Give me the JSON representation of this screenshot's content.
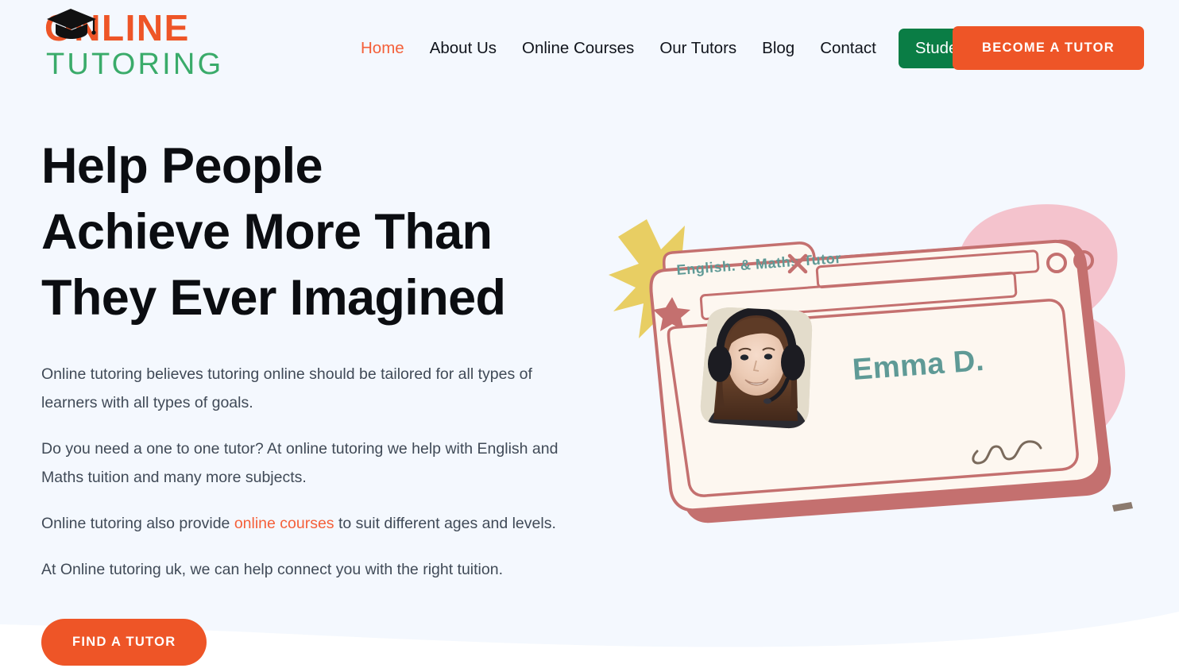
{
  "theme": {
    "bg": "#f4f8fe",
    "bg_bottom": "#ffffff",
    "accent_orange": "#ee5527",
    "accent_orange_light": "#f4603a",
    "accent_green": "#0a7d45",
    "logo_green": "#3aab6a",
    "text_dark": "#0b0d11",
    "text_body": "#404a57",
    "card_frame": "#c4706f",
    "card_fill": "#fdf7f0",
    "blob_pink": "#f4c3cd",
    "star_yellow": "#e8ce63",
    "teal_ink": "#5f9a96"
  },
  "header": {
    "logo": {
      "line1": "ONLINE",
      "line2": "TUTORING",
      "cap_icon": "graduation-cap-icon"
    },
    "nav": [
      {
        "label": "Home",
        "active": true
      },
      {
        "label": "About Us",
        "active": false
      },
      {
        "label": "Online Courses",
        "active": false
      },
      {
        "label": "Our Tutors",
        "active": false
      },
      {
        "label": "Blog",
        "active": false
      },
      {
        "label": "Contact",
        "active": false
      }
    ],
    "students_button": "Students",
    "tutor_button": "BECOME A TUTOR"
  },
  "hero": {
    "headline_line1": "Help People",
    "headline_line2": "Achieve More Than",
    "headline_line3": "They Ever Imagined",
    "paragraph1": "Online tutoring believes tutoring online should be tailored for all types of learners with all types of goals.",
    "paragraph2": "Do you need a one to one tutor? At online tutoring we help with English and Maths tuition and many more subjects.",
    "paragraph3_before": "Online tutoring also provide ",
    "paragraph3_link": "online courses",
    "paragraph3_after": " to suit different ages and levels.",
    "paragraph4": "At Online tutoring uk, we can help connect you with the right tuition.",
    "cta_button": "FIND A TUTOR"
  },
  "illustration": {
    "tab_label": "English. & Maths Tutor",
    "tutor_name": "Emma D.",
    "close_icon": "close-x-icon",
    "star_icon": "star-icon",
    "burst_icon": "star-burst-icon",
    "window_dot_1": "window-circle-icon",
    "window_dot_2": "window-circle-icon",
    "address_bar": "browser-address-bar",
    "search_bar": "browser-search-bar",
    "squiggle": "squiggle-doodle-icon",
    "avatar": "tutor-photo",
    "blob_1": "pink-blob-shape",
    "blob_2": "pink-blob-shape",
    "dash_mark": "dash-mark-icon"
  }
}
